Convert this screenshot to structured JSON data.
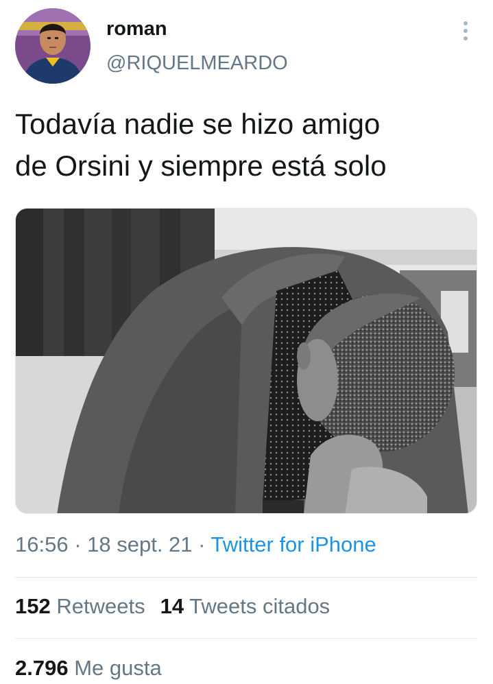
{
  "user": {
    "name": "roman",
    "handle": "@RIQUELMEARDO",
    "avatar_icon": "profile-photo-icon"
  },
  "menu_icon": "vertical-ellipsis-icon",
  "tweet": {
    "line1": "Todavía nadie se hizo amigo",
    "line2": "de Orsini y siempre está solo",
    "media_icon": "photo-man-bowing-head-icon"
  },
  "meta": {
    "time": "16:56",
    "sep1": " · ",
    "date": "18 sept. 21",
    "sep2": " · ",
    "source": "Twitter for iPhone"
  },
  "stats": {
    "retweets_count": "152",
    "retweets_label": "Retweets",
    "quotes_count": "14",
    "quotes_label": "Tweets citados",
    "likes_count": "2.796",
    "likes_label": "Me gusta"
  },
  "colors": {
    "text": "#14171a",
    "secondary": "#657786",
    "link": "#1b95e0",
    "divider": "#e1e8ed"
  }
}
